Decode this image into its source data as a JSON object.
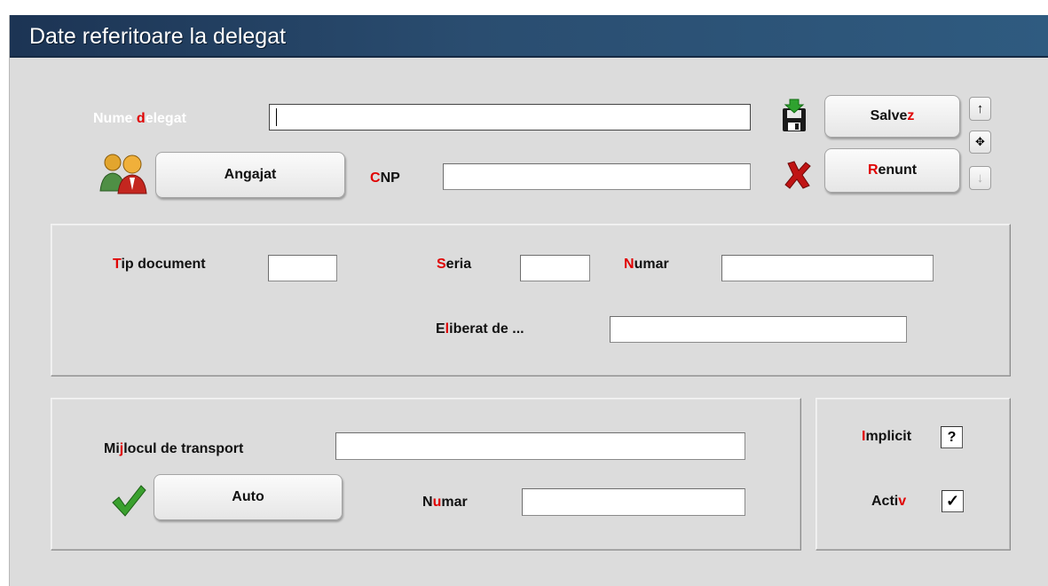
{
  "window": {
    "title": "Date referitoare la delegat"
  },
  "delegat": {
    "name_label_pre": "Nume ",
    "name_label_hk": "d",
    "name_label_post": "elegat",
    "name_value": "",
    "cnp_label_hk": "C",
    "cnp_label_post": "NP",
    "cnp_value": ""
  },
  "buttons": {
    "angajat": "Angajat",
    "save_pre": "Salve",
    "save_hk": "z",
    "cancel_hk": "R",
    "cancel_post": "enunt",
    "auto": "Auto"
  },
  "nav": {
    "up": "↑",
    "move": "✥",
    "down": "↓"
  },
  "document": {
    "tip_hk": "T",
    "tip_post": "ip document",
    "tip_value": "",
    "seria_hk": "S",
    "seria_post": "eria",
    "seria_value": "",
    "numar_hk": "N",
    "numar_post": "umar",
    "numar_value": "",
    "eliberat_pre": "E",
    "eliberat_hk": "l",
    "eliberat_post": "iberat de ...",
    "eliberat_value": ""
  },
  "transport": {
    "mijloc_pre": "Mi",
    "mijloc_hk": "j",
    "mijloc_post": "locul de transport",
    "mijloc_value": "",
    "numar_pre": "N",
    "numar_hk": "u",
    "numar_post": "mar",
    "numar_value": ""
  },
  "flags": {
    "implicit_hk": "I",
    "implicit_post": "mplicit",
    "implicit_state": "?",
    "activ_pre": "Acti",
    "activ_hk": "v",
    "activ_state": "✓"
  },
  "icons": {
    "save": "save-disk-icon",
    "cancel": "red-x-icon",
    "employee": "people-icon",
    "auto": "green-check-icon"
  },
  "colors": {
    "title_bg": "#2a4d70",
    "hotkey": "#e00000",
    "window_bg": "#dcdcdc"
  }
}
